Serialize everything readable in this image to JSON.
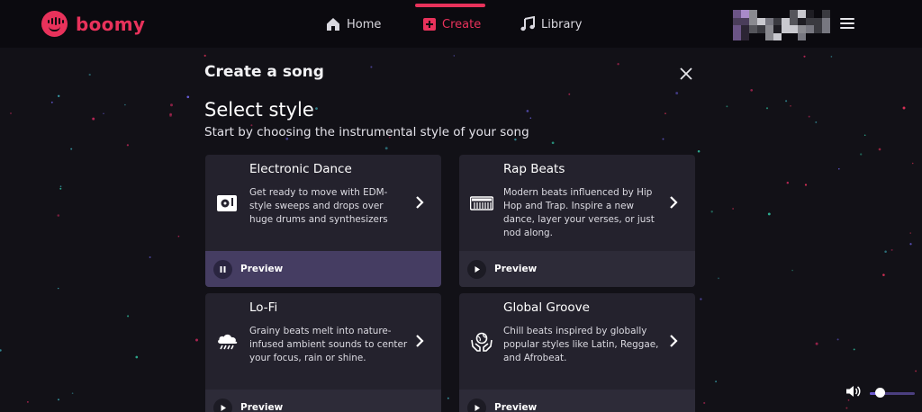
{
  "brand": {
    "name": "boomy",
    "color": "#e8325b"
  },
  "nav": {
    "items": [
      {
        "label": "Home",
        "icon": "home-icon"
      },
      {
        "label": "Create",
        "icon": "plus-square-icon",
        "active": true
      },
      {
        "label": "Library",
        "icon": "music-note-icon"
      }
    ]
  },
  "user": {
    "avatar": "pixelated-avatar"
  },
  "modal": {
    "title": "Create a song",
    "heading": "Select style",
    "subheading": "Start by choosing the instrumental style of your song",
    "preview_label": "Preview",
    "styles": [
      {
        "title": "Electronic Dance",
        "description": "Get ready to move with EDM-style sweeps and drops over huge drums and synthesizers",
        "icon": "turntable-icon",
        "preview_state": "playing"
      },
      {
        "title": "Rap Beats",
        "description": "Modern beats influenced by Hip Hop and Trap. Inspire a new dance, layer your verses, or just nod along.",
        "icon": "keyboard-icon",
        "preview_state": "paused"
      },
      {
        "title": "Lo-Fi",
        "description": "Grainy beats melt into nature-infused ambient sounds to center your focus, rain or shine.",
        "icon": "rain-cloud-icon",
        "preview_state": "paused"
      },
      {
        "title": "Global Groove",
        "description": "Chill beats inspired by globally popular styles like Latin, Reggae, and Afrobeat.",
        "icon": "globe-hands-icon",
        "preview_state": "paused"
      }
    ]
  },
  "volume": {
    "level": 0.22
  },
  "colors": {
    "accent": "#e8325b",
    "background": "#121117",
    "card": "#24222d",
    "preview_active": "#453d62"
  }
}
